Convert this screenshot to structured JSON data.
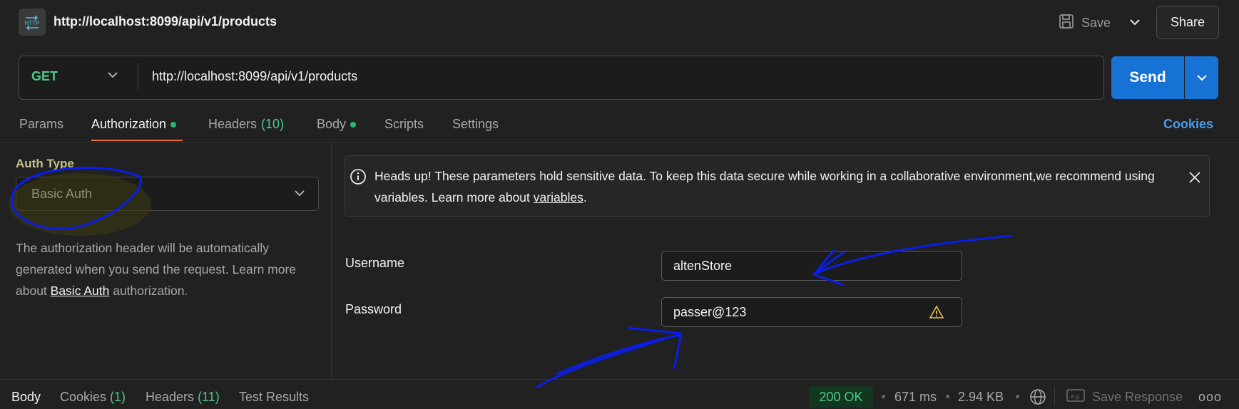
{
  "header": {
    "request_title": "http://localhost:8099/api/v1/products",
    "save_label": "Save",
    "share_label": "Share"
  },
  "url_bar": {
    "method": "GET",
    "url": "http://localhost:8099/api/v1/products",
    "send_label": "Send"
  },
  "tabs": {
    "params": "Params",
    "authorization": "Authorization",
    "headers": "Headers",
    "headers_count": "(10)",
    "body": "Body",
    "scripts": "Scripts",
    "settings": "Settings",
    "cookies": "Cookies"
  },
  "auth": {
    "type_label": "Auth Type",
    "selected_type": "Basic Auth",
    "help_prefix": "The authorization header will be automatically generated when you send the request. Learn more about ",
    "help_link": "Basic Auth",
    "help_suffix": " authorization."
  },
  "banner": {
    "text_prefix": "Heads up! These parameters hold sensitive data. To keep this data secure while working in a collaborative environment,we recommend using variables. Learn more about ",
    "link": "variables",
    "text_suffix": "."
  },
  "fields": {
    "username_label": "Username",
    "username_value": "altenStore",
    "password_label": "Password",
    "password_value": "passer@123"
  },
  "response": {
    "body_tab": "Body",
    "cookies_tab": "Cookies",
    "cookies_count": "(1)",
    "headers_tab": "Headers",
    "headers_count": "(11)",
    "test_results_tab": "Test Results",
    "status": "200 OK",
    "time": "671 ms",
    "size": "2.94 KB",
    "save_response_label": "Save Response",
    "more": "ooo"
  },
  "colors": {
    "accent_blue": "#1672d4",
    "method_green": "#4ec98a",
    "active_tab_underline": "#e8733a",
    "cookies_link": "#4b9ce8",
    "annotation_blue": "#0a1ee8",
    "annotation_highlight": "#3d3a10"
  },
  "icons": {
    "http": "http-request-icon",
    "save": "save-icon",
    "info": "info-icon",
    "close": "close-icon",
    "warning": "warning-icon",
    "globe": "globe-icon",
    "save_response": "save-response-icon"
  }
}
